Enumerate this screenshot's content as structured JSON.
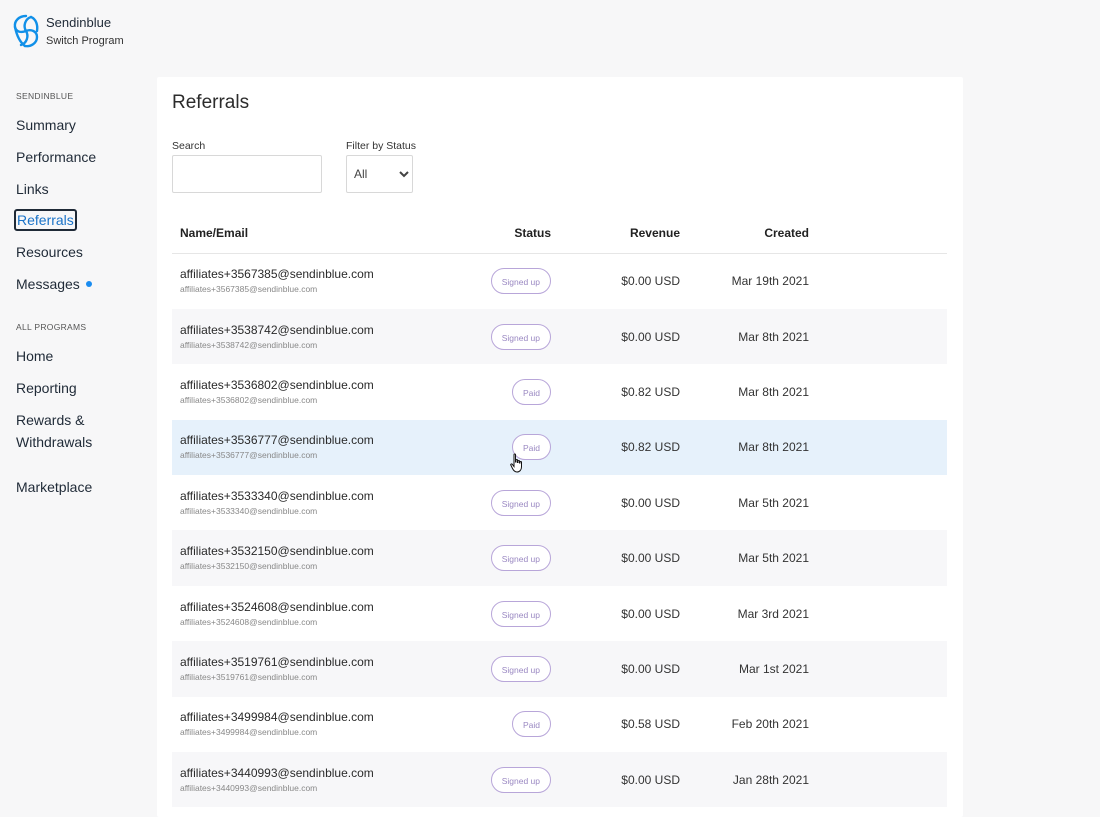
{
  "brand": {
    "name": "Sendinblue",
    "subtitle": "Switch Program"
  },
  "sidebar": {
    "section1": "SENDINBLUE",
    "items1": [
      {
        "label": "Summary"
      },
      {
        "label": "Performance"
      },
      {
        "label": "Links"
      },
      {
        "label": "Referrals",
        "active": true
      },
      {
        "label": "Resources"
      },
      {
        "label": "Messages",
        "has_dot": true
      }
    ],
    "section2": "ALL PROGRAMS",
    "items2": [
      {
        "label": "Home"
      },
      {
        "label": "Reporting"
      },
      {
        "label": "Rewards &"
      },
      {
        "label": "Withdrawals"
      },
      {
        "label": "Marketplace"
      }
    ]
  },
  "main": {
    "title": "Referrals",
    "search_label": "Search",
    "search_value": "",
    "filter_label": "Filter by Status",
    "filter_selected": "All",
    "columns": {
      "name": "Name/Email",
      "status": "Status",
      "revenue": "Revenue",
      "created": "Created"
    },
    "rows": [
      {
        "email": "affiliates+3567385@sendinblue.com",
        "sub": "affiliates+3567385@sendinblue.com",
        "status": "Signed up",
        "revenue": "$0.00 USD",
        "created": "Mar 19th 2021"
      },
      {
        "email": "affiliates+3538742@sendinblue.com",
        "sub": "affiliates+3538742@sendinblue.com",
        "status": "Signed up",
        "revenue": "$0.00 USD",
        "created": "Mar 8th 2021"
      },
      {
        "email": "affiliates+3536802@sendinblue.com",
        "sub": "affiliates+3536802@sendinblue.com",
        "status": "Paid",
        "revenue": "$0.82 USD",
        "created": "Mar 8th 2021"
      },
      {
        "email": "affiliates+3536777@sendinblue.com",
        "sub": "affiliates+3536777@sendinblue.com",
        "status": "Paid",
        "revenue": "$0.82 USD",
        "created": "Mar 8th 2021"
      },
      {
        "email": "affiliates+3533340@sendinblue.com",
        "sub": "affiliates+3533340@sendinblue.com",
        "status": "Signed up",
        "revenue": "$0.00 USD",
        "created": "Mar 5th 2021"
      },
      {
        "email": "affiliates+3532150@sendinblue.com",
        "sub": "affiliates+3532150@sendinblue.com",
        "status": "Signed up",
        "revenue": "$0.00 USD",
        "created": "Mar 5th 2021"
      },
      {
        "email": "affiliates+3524608@sendinblue.com",
        "sub": "affiliates+3524608@sendinblue.com",
        "status": "Signed up",
        "revenue": "$0.00 USD",
        "created": "Mar 3rd 2021"
      },
      {
        "email": "affiliates+3519761@sendinblue.com",
        "sub": "affiliates+3519761@sendinblue.com",
        "status": "Signed up",
        "revenue": "$0.00 USD",
        "created": "Mar 1st 2021"
      },
      {
        "email": "affiliates+3499984@sendinblue.com",
        "sub": "affiliates+3499984@sendinblue.com",
        "status": "Paid",
        "revenue": "$0.58 USD",
        "created": "Feb 20th 2021"
      },
      {
        "email": "affiliates+3440993@sendinblue.com",
        "sub": "affiliates+3440993@sendinblue.com",
        "status": "Signed up",
        "revenue": "$0.00 USD",
        "created": "Jan 28th 2021"
      }
    ]
  },
  "colors": {
    "accent": "#1a8cf0",
    "badge_border": "#b8a6d9",
    "hover_row": "#e6f1fb"
  },
  "icons": {
    "logo": "sendinblue-logo-icon",
    "cursor": "hand-pointer-icon"
  }
}
